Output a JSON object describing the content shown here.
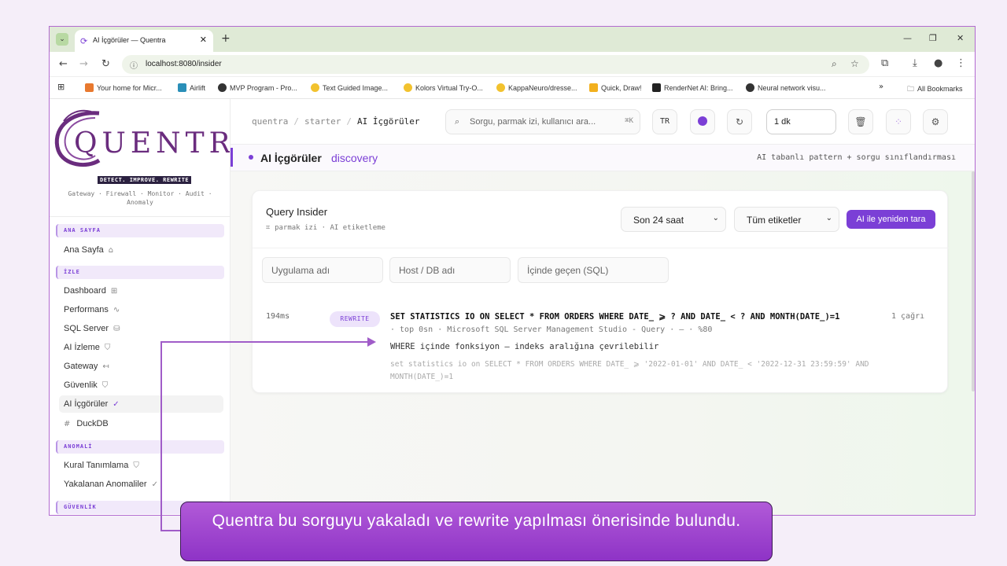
{
  "browser": {
    "tab_title": "AI İçgörüler — Quentra",
    "url": "localhost:8080/insider",
    "bookmarks": [
      {
        "label": "Your home for Micr...",
        "color": "#e8792f"
      },
      {
        "label": "Airlift",
        "color": "#2a8fb8"
      },
      {
        "label": "MVP Program - Pro...",
        "color": "#333333"
      },
      {
        "label": "Text Guided Image...",
        "color": "#f2c22e"
      },
      {
        "label": "Kolors Virtual Try-O...",
        "color": "#f2c22e"
      },
      {
        "label": "KappaNeuro/dresse...",
        "color": "#f2c22e"
      },
      {
        "label": "Quick, Draw!",
        "color": "#f2b01e"
      },
      {
        "label": "RenderNet AI: Bring...",
        "color": "#222222"
      },
      {
        "label": "Neural network visu...",
        "color": "#333333"
      }
    ],
    "all_bookmarks": "All Bookmarks"
  },
  "sidebar": {
    "logo_text": "QUENTRA",
    "tagline": "DETECT. IMPROVE. REWRITE",
    "subtag": "Gateway · Firewall · Monitor · Audit · Anomaly",
    "sections": {
      "home": "ANA SAYFA",
      "monitor": "İZLE",
      "anomaly": "ANOMALİ",
      "security": "GÜVENLİK"
    },
    "items": {
      "home": "Ana Sayfa",
      "dashboard": "Dashboard",
      "performance": "Performans",
      "sqlserver": "SQL Server",
      "ai_monitor": "AI İzleme",
      "gateway": "Gateway",
      "security": "Güvenlik",
      "ai_insights": "AI İçgörüler",
      "duckdb": "DuckDB",
      "rules": "Kural Tanımlama",
      "anomalies": "Yakalanan Anomaliler"
    }
  },
  "topbar": {
    "crumbs": [
      "quentra",
      "starter",
      "AI İçgörüler"
    ],
    "search_placeholder": "Sorgu, parmak izi, kullanıcı ara...",
    "search_kbd": "⌘K",
    "lang": "TR",
    "interval": "1 dk"
  },
  "page": {
    "title": "AI İçgörüler",
    "subtitle": "discovery",
    "right_text": "AI tabanlı pattern + sorgu sınıflandırması"
  },
  "card": {
    "title": "Query Insider",
    "subtitle": "parmak izi · AI etiketleme",
    "time_range": "Son 24 saat",
    "tags": "Tüm etiketler",
    "rescan_button": "AI ile yeniden tara",
    "filters": {
      "app": "Uygulama adı",
      "host": "Host / DB adı",
      "sql": "İçinde geçen (SQL)"
    }
  },
  "query": {
    "duration": "194ms",
    "badge": "REWRITE",
    "sql": "SET STATISTICS IO ON SELECT * FROM ORDERS WHERE DATE_ ⩾ ? AND DATE_ < ? AND MONTH(DATE_)=1",
    "calls": "1 çağrı",
    "meta": "· top 0sn · Microsoft SQL Server Management Studio - Query · — · %80",
    "reason": "WHERE içinde fonksiyon — indeks aralığına çevrilebilir",
    "raw": "set statistics io on SELECT * FROM ORDERS WHERE DATE_ ⩾ '2022-01-01' AND DATE_ < '2022-12-31 23:59:59' AND MONTH(DATE_)=1"
  },
  "callout": {
    "text": "Quentra bu sorguyu yakaladı ve rewrite yapılması önerisinde bulundu."
  },
  "colors": {
    "accent": "#7b3fd6",
    "logo": "#6a2c7e",
    "callout": "#a04ccf"
  }
}
